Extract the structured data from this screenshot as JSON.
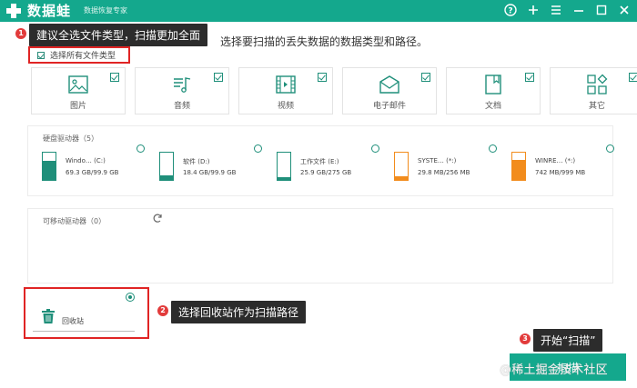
{
  "app": {
    "name": "数据蛙",
    "subtitle": "数据恢复专家",
    "brand_color": "#14a88d"
  },
  "window_controls": [
    "help-icon",
    "plus-icon",
    "menu-icon",
    "minimize-icon",
    "maximize-icon",
    "close-icon"
  ],
  "main_hint": "选择要扫描的丢失数据的数据类型和路径。",
  "callouts": {
    "c1": {
      "num": "1",
      "text": "建议全选文件类型，扫描更加全面"
    },
    "c2": {
      "num": "2",
      "text": "选择回收站作为扫描路径"
    },
    "c3": {
      "num": "3",
      "text": "开始“扫描”"
    }
  },
  "select_all": {
    "label": "选择所有文件类型",
    "checked": true
  },
  "file_types": [
    {
      "label": "图片",
      "icon": "image-icon",
      "checked": true
    },
    {
      "label": "音频",
      "icon": "audio-icon",
      "checked": true
    },
    {
      "label": "视频",
      "icon": "video-icon",
      "checked": true
    },
    {
      "label": "电子邮件",
      "icon": "email-icon",
      "checked": true
    },
    {
      "label": "文档",
      "icon": "document-icon",
      "checked": true
    },
    {
      "label": "其它",
      "icon": "other-icon",
      "checked": true
    }
  ],
  "hard_drives": {
    "title": "硬盘驱动器（5）",
    "items": [
      {
        "name": "Windo… (C:)",
        "size": "69.3 GB/99.9 GB",
        "used": 0.69,
        "color": "#1f8f7a"
      },
      {
        "name": "软件 (D:)",
        "size": "18.4 GB/99.9 GB",
        "used": 0.18,
        "color": "#1f8f7a"
      },
      {
        "name": "工作文件 (E:)",
        "size": "25.9 GB/275 GB",
        "used": 0.09,
        "color": "#1f8f7a"
      },
      {
        "name": "SYSTE… (*:)",
        "size": "29.8 MB/256 MB",
        "used": 0.12,
        "color": "#f28c1c"
      },
      {
        "name": "WINRE… (*:)",
        "size": "742 MB/999 MB",
        "used": 0.74,
        "color": "#f28c1c"
      }
    ]
  },
  "removable": {
    "title": "可移动驱动器（0）"
  },
  "recycle_bin": {
    "label": "回收站",
    "selected": true
  },
  "start_button": {
    "label": "扫描"
  },
  "watermark": "@稀土掘金技术社区"
}
